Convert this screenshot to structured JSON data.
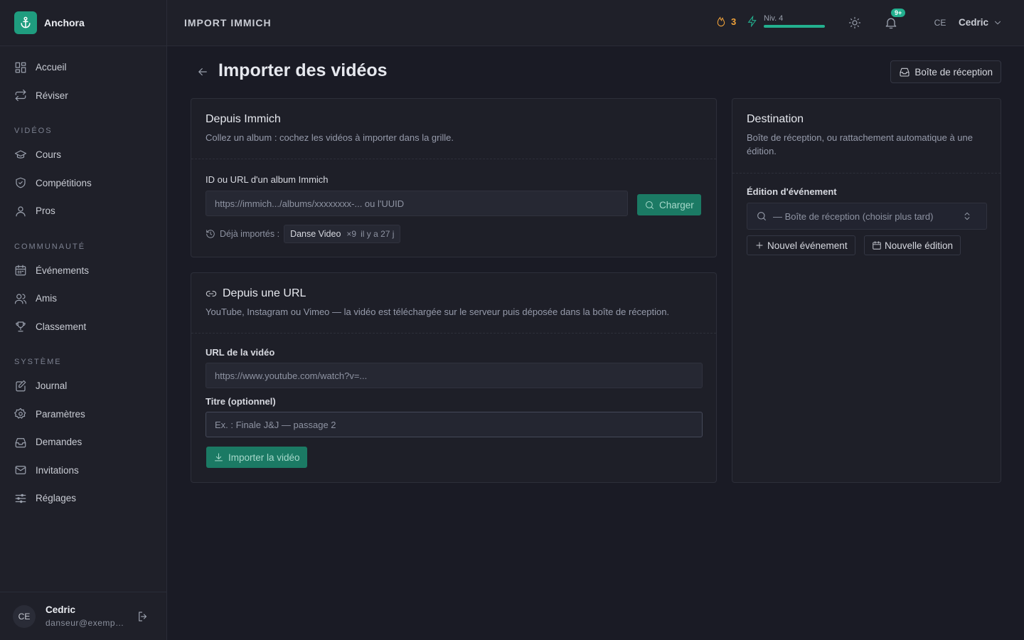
{
  "app": {
    "name": "Anchora"
  },
  "sidebar": {
    "items_main": [
      {
        "label": "Accueil",
        "icon": "dashboard-icon"
      },
      {
        "label": "Réviser",
        "icon": "repeat-icon"
      }
    ],
    "section_videos": "VIDÉOS",
    "items_videos": [
      {
        "label": "Cours",
        "icon": "graduation-cap-icon"
      },
      {
        "label": "Compétitions",
        "icon": "medal-icon"
      },
      {
        "label": "Pros",
        "icon": "user-icon"
      }
    ],
    "section_community": "COMMUNAUTÉ",
    "items_community": [
      {
        "label": "Événements",
        "icon": "calendar-icon"
      },
      {
        "label": "Amis",
        "icon": "users-icon"
      },
      {
        "label": "Classement",
        "icon": "trophy-icon"
      }
    ],
    "section_system": "SYSTÈME",
    "items_system": [
      {
        "label": "Journal",
        "icon": "journal-icon"
      },
      {
        "label": "Paramètres",
        "icon": "gear-icon"
      },
      {
        "label": "Demandes",
        "icon": "inbox-icon"
      },
      {
        "label": "Invitations",
        "icon": "mail-icon"
      },
      {
        "label": "Réglages",
        "icon": "sliders-icon"
      }
    ],
    "user": {
      "initials": "CE",
      "name": "Cedric",
      "email": "danseur@exempl..."
    }
  },
  "topbar": {
    "title": "IMPORT IMMICH",
    "streak": "3",
    "level": "Niv. 4",
    "level_progress": 1.0,
    "notifications_badge": "9+",
    "user_initials": "CE",
    "user_name": "Cedric"
  },
  "page": {
    "title": "Importer des vidéos",
    "inbox_button": "Boîte de réception"
  },
  "immich": {
    "title": "Depuis Immich",
    "subtitle": "Collez un album : cochez les vidéos à importer dans la grille.",
    "field_label": "ID ou URL d'un album Immich",
    "placeholder": "https://immich.../albums/xxxxxxxx-...  ou l'UUID",
    "load_button": "Charger",
    "imported_label": "Déjà importés :",
    "imported_chip": {
      "name": "Danse Video",
      "count": "×9",
      "age": "il y a 27 j"
    }
  },
  "url_import": {
    "title": "Depuis une URL",
    "subtitle": "YouTube, Instagram ou Vimeo — la vidéo est téléchargée sur le serveur puis déposée dans la boîte de réception.",
    "url_label": "URL de la vidéo",
    "url_placeholder": "https://www.youtube.com/watch?v=...",
    "title_label": "Titre (optionnel)",
    "title_placeholder": "Ex. : Finale J&J — passage 2",
    "import_button": "Importer la vidéo"
  },
  "destination": {
    "title": "Destination",
    "subtitle": "Boîte de réception, ou rattachement automatique à une édition.",
    "edition_label": "Édition d'événement",
    "edition_value": "— Boîte de réception (choisir plus tard)",
    "new_event_button": "Nouvel événement",
    "new_edition_button": "Nouvelle édition"
  },
  "colors": {
    "accent": "#1f9d7f",
    "streak": "#f0a23a",
    "background": "#1a1b25"
  }
}
